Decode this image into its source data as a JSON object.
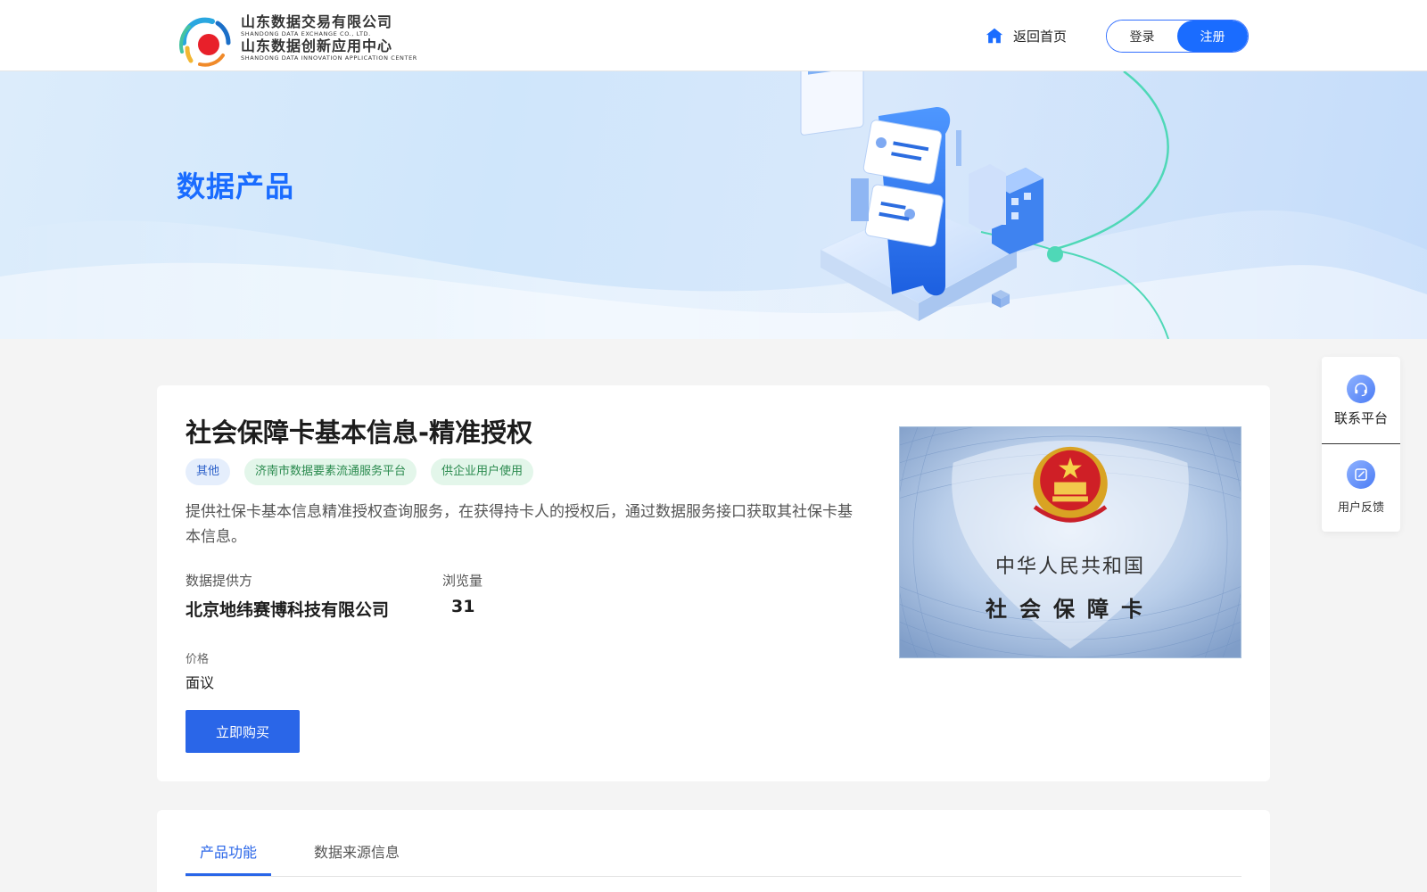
{
  "header": {
    "logo": {
      "line1_cn": "山东数据交易有限公司",
      "line1_en": "SHANDONG DATA EXCHANGE CO., LTD.",
      "line2_cn": "山东数据创新应用中心",
      "line2_en": "SHANDONG DATA INNOVATION APPLICATION CENTER"
    },
    "home_label": "返回首页",
    "login_label": "登录",
    "register_label": "注册"
  },
  "banner": {
    "title": "数据产品"
  },
  "product": {
    "title": "社会保障卡基本信息-精准授权",
    "tags": [
      "其他",
      "济南市数据要素流通服务平台",
      "供企业用户使用"
    ],
    "description": "提供社保卡基本信息精准授权查询服务，在获得持卡人的授权后，通过数据服务接口获取其社保卡基本信息。",
    "provider_label": "数据提供方",
    "provider_value": "北京地纬赛博科技有限公司",
    "views_label": "浏览量",
    "views_value": "31",
    "price_label": "价格",
    "price_value": "面议",
    "buy_label": "立即购买",
    "image_text_line1": "中华人民共和国",
    "image_text_line2": "社会保障卡"
  },
  "tabs": {
    "items": [
      "产品功能",
      "数据来源信息"
    ],
    "active": 0
  },
  "side_widget": {
    "contact_label": "联系平台",
    "feedback_label": "用户反馈"
  },
  "colors": {
    "accent": "#1a6cff",
    "button": "#2a66e8"
  }
}
